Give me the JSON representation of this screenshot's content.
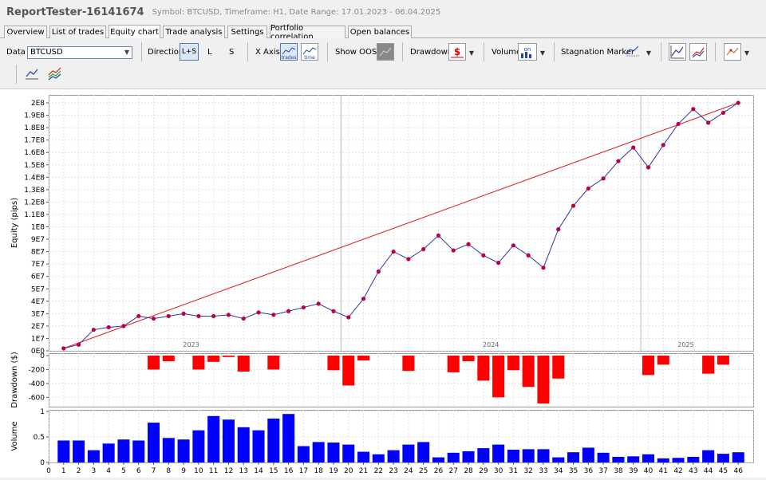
{
  "window": {
    "title": "ReportTester-16141674",
    "subtitle": "Symbol: BTCUSD, Timeframe: H1, Date Range: 17.01.2023 - 06.04.2025"
  },
  "tabs": [
    "Overview",
    "List of trades",
    "Equity chart",
    "Trade analysis",
    "Settings",
    "Portfolio correlation",
    "Open balances"
  ],
  "active_tab": "Equity chart",
  "toolbar": {
    "data_label": "Data",
    "data_value": "BTCUSD",
    "direction_label": "Direction",
    "direction_options": [
      "L+S",
      "L",
      "S"
    ],
    "xaxis_label": "X Axis",
    "xaxis_trades": "trades",
    "xaxis_time": "time",
    "show_oos_label": "Show OOS",
    "drawdown_label": "Drawdown",
    "volume_label": "Volume",
    "volume_icon_text": "on",
    "stagnation_label": "Stagnation Marker"
  },
  "colors": {
    "equity_line": "#3333aa",
    "equity_point": "#c0003c",
    "trend_line": "#e02020",
    "drawdown_bar": "#ff0000",
    "volume_bar": "#0000ff"
  },
  "chart_data": [
    {
      "type": "line",
      "ylabel": "Equity (pips)",
      "ylim": [
        0,
        200000000
      ],
      "y_ticks": [
        "0E0",
        "1E7",
        "2E7",
        "3E7",
        "4E7",
        "5E7",
        "6E7",
        "7E7",
        "8E7",
        "9E7",
        "1E8",
        "1.1E8",
        "1.2E8",
        "1.3E8",
        "1.4E8",
        "1.5E8",
        "1.6E8",
        "1.7E8",
        "1.8E8",
        "1.9E8",
        "2E8"
      ],
      "year_labels": [
        {
          "text": "2023",
          "trade": 9.5
        },
        {
          "text": "2024",
          "trade": 29.5
        },
        {
          "text": "2025",
          "trade": 42.5
        }
      ],
      "year_dividers": [
        19.5,
        39.5
      ],
      "x": [
        1,
        2,
        3,
        4,
        5,
        6,
        7,
        8,
        9,
        10,
        11,
        12,
        13,
        14,
        15,
        16,
        17,
        18,
        19,
        20,
        21,
        22,
        23,
        24,
        25,
        26,
        27,
        28,
        29,
        30,
        31,
        32,
        33,
        34,
        35,
        36,
        37,
        38,
        39,
        40,
        41,
        42,
        43,
        44,
        45,
        46
      ],
      "values": [
        2000000,
        5000000,
        17000000,
        19000000,
        20000000,
        28000000,
        26000000,
        28000000,
        30000000,
        28000000,
        28000000,
        29000000,
        26000000,
        31000000,
        29000000,
        32000000,
        35000000,
        38000000,
        32000000,
        27000000,
        42000000,
        64000000,
        80000000,
        74000000,
        82000000,
        93000000,
        81000000,
        86000000,
        77000000,
        71000000,
        85000000,
        77000000,
        67000000,
        98000000,
        117000000,
        131000000,
        139000000,
        153000000,
        164000000,
        148000000,
        166000000,
        183000000,
        195000000,
        184000000,
        192000000,
        200000000
      ],
      "trend": [
        [
          1,
          2000000
        ],
        [
          46,
          200000000
        ]
      ]
    },
    {
      "type": "bar",
      "ylabel": "Drawdown ($)",
      "ylim": [
        -700,
        0
      ],
      "y_ticks": [
        "0",
        "-200",
        "-400",
        "-600"
      ],
      "x": [
        1,
        2,
        3,
        4,
        5,
        6,
        7,
        8,
        9,
        10,
        11,
        12,
        13,
        14,
        15,
        16,
        17,
        18,
        19,
        20,
        21,
        22,
        23,
        24,
        25,
        26,
        27,
        28,
        29,
        30,
        31,
        32,
        33,
        34,
        35,
        36,
        37,
        38,
        39,
        40,
        41,
        42,
        43,
        44,
        45,
        46
      ],
      "values": [
        0,
        0,
        0,
        0,
        0,
        0,
        -200,
        -80,
        0,
        -200,
        -90,
        -20,
        -230,
        0,
        -200,
        0,
        0,
        0,
        -210,
        -430,
        -70,
        0,
        0,
        -220,
        0,
        0,
        -240,
        -80,
        -360,
        -600,
        -210,
        -450,
        -690,
        -330,
        0,
        0,
        0,
        0,
        0,
        -280,
        -130,
        0,
        0,
        -260,
        -130,
        0
      ]
    },
    {
      "type": "bar",
      "ylabel": "Volume",
      "ylim": [
        0,
        1
      ],
      "y_ticks": [
        "0",
        "0.5",
        "1"
      ],
      "x_ticks": [
        "0",
        "1",
        "2",
        "3",
        "4",
        "5",
        "6",
        "7",
        "8",
        "9",
        "10",
        "11",
        "12",
        "13",
        "14",
        "15",
        "16",
        "17",
        "18",
        "19",
        "20",
        "21",
        "22",
        "23",
        "24",
        "25",
        "26",
        "27",
        "28",
        "29",
        "30",
        "31",
        "32",
        "33",
        "34",
        "35",
        "36",
        "37",
        "38",
        "39",
        "40",
        "41",
        "42",
        "43",
        "44",
        "45",
        "46"
      ],
      "x": [
        1,
        2,
        3,
        4,
        5,
        6,
        7,
        8,
        9,
        10,
        11,
        12,
        13,
        14,
        15,
        16,
        17,
        18,
        19,
        20,
        21,
        22,
        23,
        24,
        25,
        26,
        27,
        28,
        29,
        30,
        31,
        32,
        33,
        34,
        35,
        36,
        37,
        38,
        39,
        40,
        41,
        42,
        43,
        44,
        45,
        46
      ],
      "values": [
        0.43,
        0.43,
        0.24,
        0.37,
        0.45,
        0.43,
        0.78,
        0.48,
        0.45,
        0.63,
        0.91,
        0.84,
        0.69,
        0.63,
        0.86,
        0.95,
        0.32,
        0.4,
        0.39,
        0.35,
        0.21,
        0.16,
        0.24,
        0.35,
        0.4,
        0.1,
        0.19,
        0.22,
        0.28,
        0.35,
        0.25,
        0.26,
        0.26,
        0.1,
        0.2,
        0.29,
        0.19,
        0.11,
        0.12,
        0.16,
        0.08,
        0.09,
        0.11,
        0.24,
        0.17,
        0.2
      ]
    }
  ]
}
